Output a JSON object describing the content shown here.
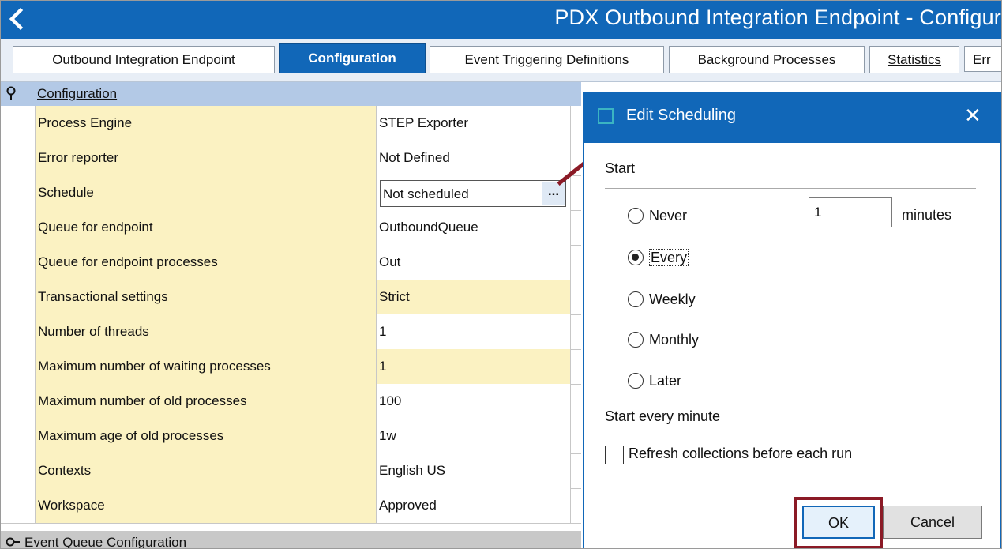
{
  "window": {
    "title": "PDX Outbound Integration Endpoint - Configur"
  },
  "tabs": [
    {
      "label": "Outbound Integration Endpoint",
      "active": false
    },
    {
      "label": "Configuration",
      "active": true
    },
    {
      "label": "Event Triggering Definitions",
      "active": false
    },
    {
      "label": "Background Processes",
      "active": false
    },
    {
      "label": "Statistics",
      "active": false
    },
    {
      "label": "Err",
      "active": false
    }
  ],
  "section": {
    "label": "Configuration"
  },
  "rows": [
    {
      "name": "Process Engine",
      "value": "STEP Exporter"
    },
    {
      "name": "Error reporter",
      "value": "Not Defined"
    },
    {
      "name": "Schedule",
      "value": "Not scheduled"
    },
    {
      "name": "Queue for endpoint",
      "value": "OutboundQueue"
    },
    {
      "name": "Queue for endpoint processes",
      "value": "Out"
    },
    {
      "name": "Transactional settings",
      "value": "Strict"
    },
    {
      "name": "Number of threads",
      "value": "1"
    },
    {
      "name": "Maximum number of waiting processes",
      "value": "1"
    },
    {
      "name": "Maximum number of old processes",
      "value": "100"
    },
    {
      "name": "Maximum age of old processes",
      "value": "1w"
    },
    {
      "name": "Contexts",
      "value": "English US"
    },
    {
      "name": "Workspace",
      "value": "Approved"
    }
  ],
  "schedule_button": "...",
  "section2": {
    "label": "Event Queue Configuration"
  },
  "dialog": {
    "title": "Edit Scheduling",
    "close": "✕",
    "start_label": "Start",
    "options": [
      {
        "label": "Never",
        "selected": false
      },
      {
        "label": "Every",
        "selected": true
      },
      {
        "label": "Weekly",
        "selected": false
      },
      {
        "label": "Monthly",
        "selected": false
      },
      {
        "label": "Later",
        "selected": false
      }
    ],
    "minutes_value": "1",
    "minutes_label": "minutes",
    "start_every_text": "Start every minute",
    "refresh_label": "Refresh collections before each run",
    "refresh_checked": false,
    "ok_label": "OK",
    "cancel_label": "Cancel"
  },
  "colors": {
    "accent": "#1167b8",
    "highlight": "#8b1a26",
    "name_cell": "#fbf2c2"
  }
}
